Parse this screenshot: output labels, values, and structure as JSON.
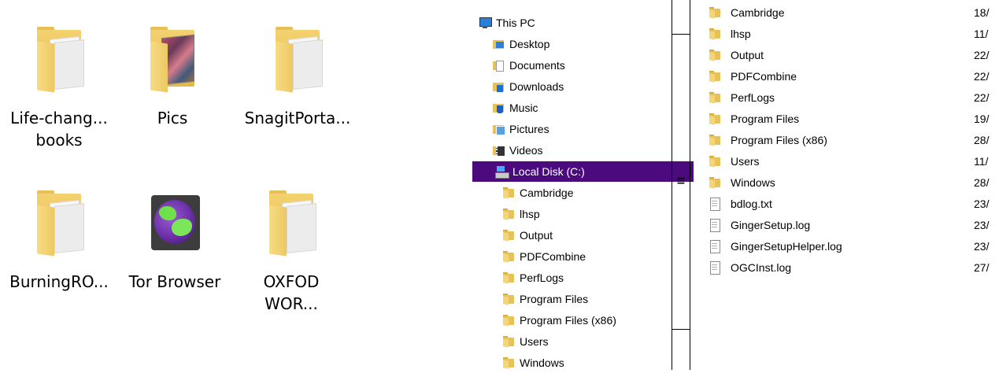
{
  "desktop": {
    "icons": [
      {
        "label": "Life-chang...\nbooks",
        "icon": "folder-icon"
      },
      {
        "label": "Pics",
        "icon": "folder-photos-icon"
      },
      {
        "label": "SnagitPorta...",
        "icon": "folder-icon"
      },
      {
        "label": "BurningRO...",
        "icon": "folder-icon"
      },
      {
        "label": "Tor Browser",
        "icon": "tor-browser-icon"
      },
      {
        "label": "OXFOD\nWOR...",
        "icon": "folder-icon"
      }
    ]
  },
  "navigation": {
    "items": [
      {
        "label": "This PC",
        "icon": "computer-icon"
      },
      {
        "label": "Desktop",
        "icon": "desktop-folder-icon"
      },
      {
        "label": "Documents",
        "icon": "documents-folder-icon"
      },
      {
        "label": "Downloads",
        "icon": "downloads-folder-icon"
      },
      {
        "label": "Music",
        "icon": "music-folder-icon"
      },
      {
        "label": "Pictures",
        "icon": "pictures-folder-icon"
      },
      {
        "label": "Videos",
        "icon": "videos-folder-icon"
      },
      {
        "label": "Local Disk (C:)",
        "icon": "local-disk-icon",
        "selected": true
      },
      {
        "label": "Cambridge",
        "icon": "folder-icon"
      },
      {
        "label": "lhsp",
        "icon": "folder-icon"
      },
      {
        "label": "Output",
        "icon": "folder-icon"
      },
      {
        "label": "PDFCombine",
        "icon": "folder-icon"
      },
      {
        "label": "PerfLogs",
        "icon": "folder-icon"
      },
      {
        "label": "Program Files",
        "icon": "folder-icon"
      },
      {
        "label": "Program Files (x86)",
        "icon": "folder-icon"
      },
      {
        "label": "Users",
        "icon": "folder-icon"
      },
      {
        "label": "Windows",
        "icon": "folder-icon"
      }
    ],
    "selected_color": "#4b0b7f"
  },
  "splitter": {
    "grip": "≡"
  },
  "files": {
    "rows": [
      {
        "name": "Cambridge",
        "date": "18/",
        "icon": "folder-icon"
      },
      {
        "name": "lhsp",
        "date": "11/",
        "icon": "folder-icon"
      },
      {
        "name": "Output",
        "date": "22/",
        "icon": "folder-icon"
      },
      {
        "name": "PDFCombine",
        "date": "22/",
        "icon": "folder-icon"
      },
      {
        "name": "PerfLogs",
        "date": "22/",
        "icon": "folder-icon"
      },
      {
        "name": "Program Files",
        "date": "19/",
        "icon": "folder-icon"
      },
      {
        "name": "Program Files (x86)",
        "date": "28/",
        "icon": "folder-icon"
      },
      {
        "name": "Users",
        "date": "11/",
        "icon": "folder-icon"
      },
      {
        "name": "Windows",
        "date": "28/",
        "icon": "folder-icon"
      },
      {
        "name": "bdlog.txt",
        "date": "23/",
        "icon": "text-file-icon"
      },
      {
        "name": "GingerSetup.log",
        "date": "23/",
        "icon": "text-file-icon"
      },
      {
        "name": "GingerSetupHelper.log",
        "date": "23/",
        "icon": "text-file-icon"
      },
      {
        "name": "OGCInst.log",
        "date": "27/",
        "icon": "text-file-icon"
      }
    ]
  }
}
